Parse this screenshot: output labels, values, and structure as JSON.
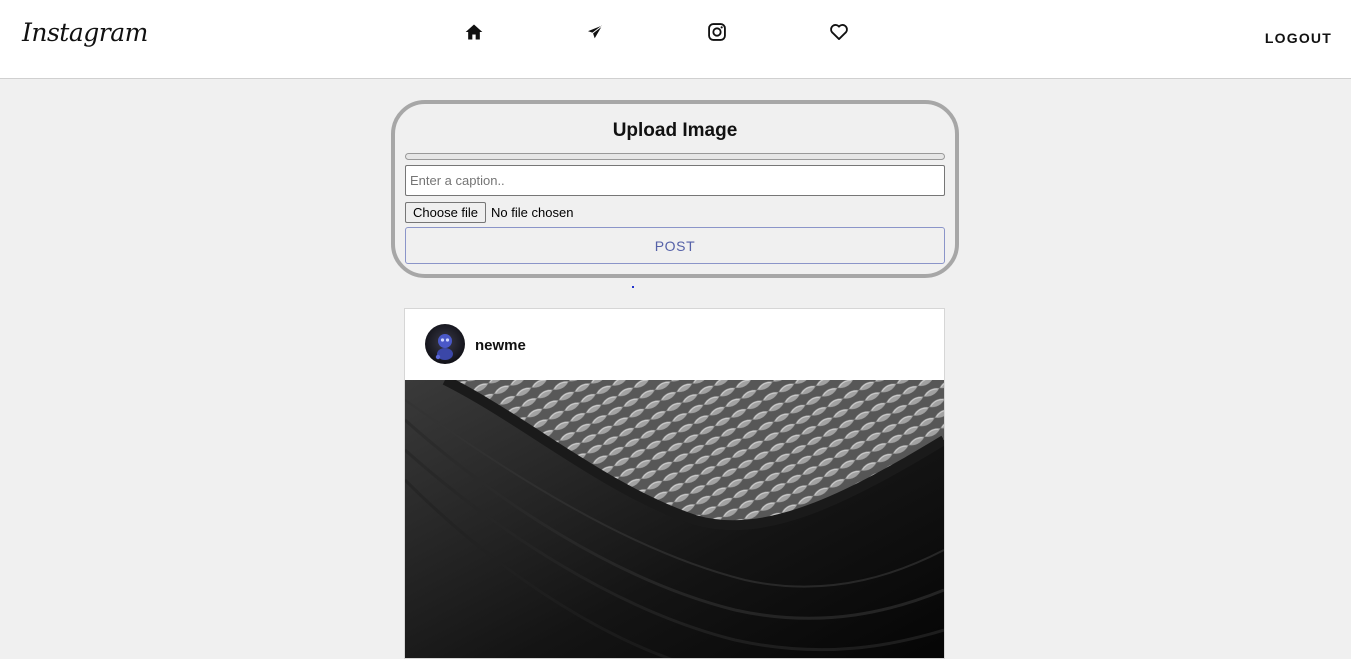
{
  "header": {
    "logo_text": "Instagram",
    "nav_icons": [
      "home-icon",
      "send-icon",
      "instagram-icon",
      "heart-icon"
    ],
    "logout_label": "LOGOUT"
  },
  "upload": {
    "title": "Upload Image",
    "progress": 0,
    "caption_placeholder": "Enter a caption..",
    "caption_value": "",
    "file_button_label": "Choose file",
    "file_status": "No file chosen",
    "post_label": "POST"
  },
  "post": {
    "username": "newme"
  },
  "colors": {
    "background": "#f0f0f0",
    "post_button_text": "#5561a8",
    "card_border": "#a7a7a7"
  }
}
